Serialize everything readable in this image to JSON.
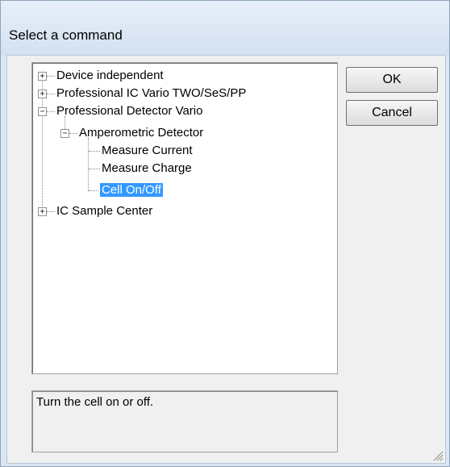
{
  "window": {
    "title": "Select a command"
  },
  "tree": {
    "items": [
      {
        "label": "Device independent",
        "expander": "+"
      },
      {
        "label": "Professional IC Vario TWO/SeS/PP",
        "expander": "+"
      },
      {
        "label": "Professional Detector Vario",
        "expander": "−"
      },
      {
        "label": "Amperometric Detector",
        "expander": "−"
      },
      {
        "label": "Measure Current"
      },
      {
        "label": "Measure Charge"
      },
      {
        "label": "Cell On/Off",
        "selected": true
      },
      {
        "label": "IC Sample Center",
        "expander": "+"
      }
    ]
  },
  "buttons": {
    "ok": "OK",
    "cancel": "Cancel"
  },
  "description": "Turn the cell on or off."
}
